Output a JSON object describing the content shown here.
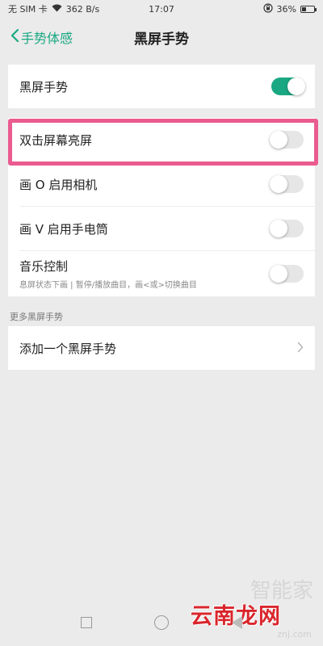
{
  "status_bar": {
    "carrier": "无 SIM 卡",
    "speed": "362 B/s",
    "time": "17:07",
    "battery_text": "36%",
    "battery_level": 0.36
  },
  "header": {
    "back_label": "手势体感",
    "title": "黑屏手势"
  },
  "colors": {
    "accent": "#1aa882",
    "highlight": "#ea5b8f",
    "watermark": "#d9262c"
  },
  "master_switch": {
    "label": "黑屏手势",
    "on": true
  },
  "gestures": [
    {
      "label": "双击屏幕亮屏",
      "on": false
    },
    {
      "label": "画 O 启用相机",
      "on": false
    },
    {
      "label": "画 V 启用手电筒",
      "on": false
    },
    {
      "label": "音乐控制",
      "sub": "息屏状态下画 | 暂停/播放曲目，画<或>切换曲目",
      "on": false
    }
  ],
  "more_section": {
    "title": "更多黑屏手势",
    "add_label": "添加一个黑屏手势"
  },
  "watermark": {
    "main": "云南龙网",
    "faint": "智能家",
    "url": "znj.com"
  }
}
